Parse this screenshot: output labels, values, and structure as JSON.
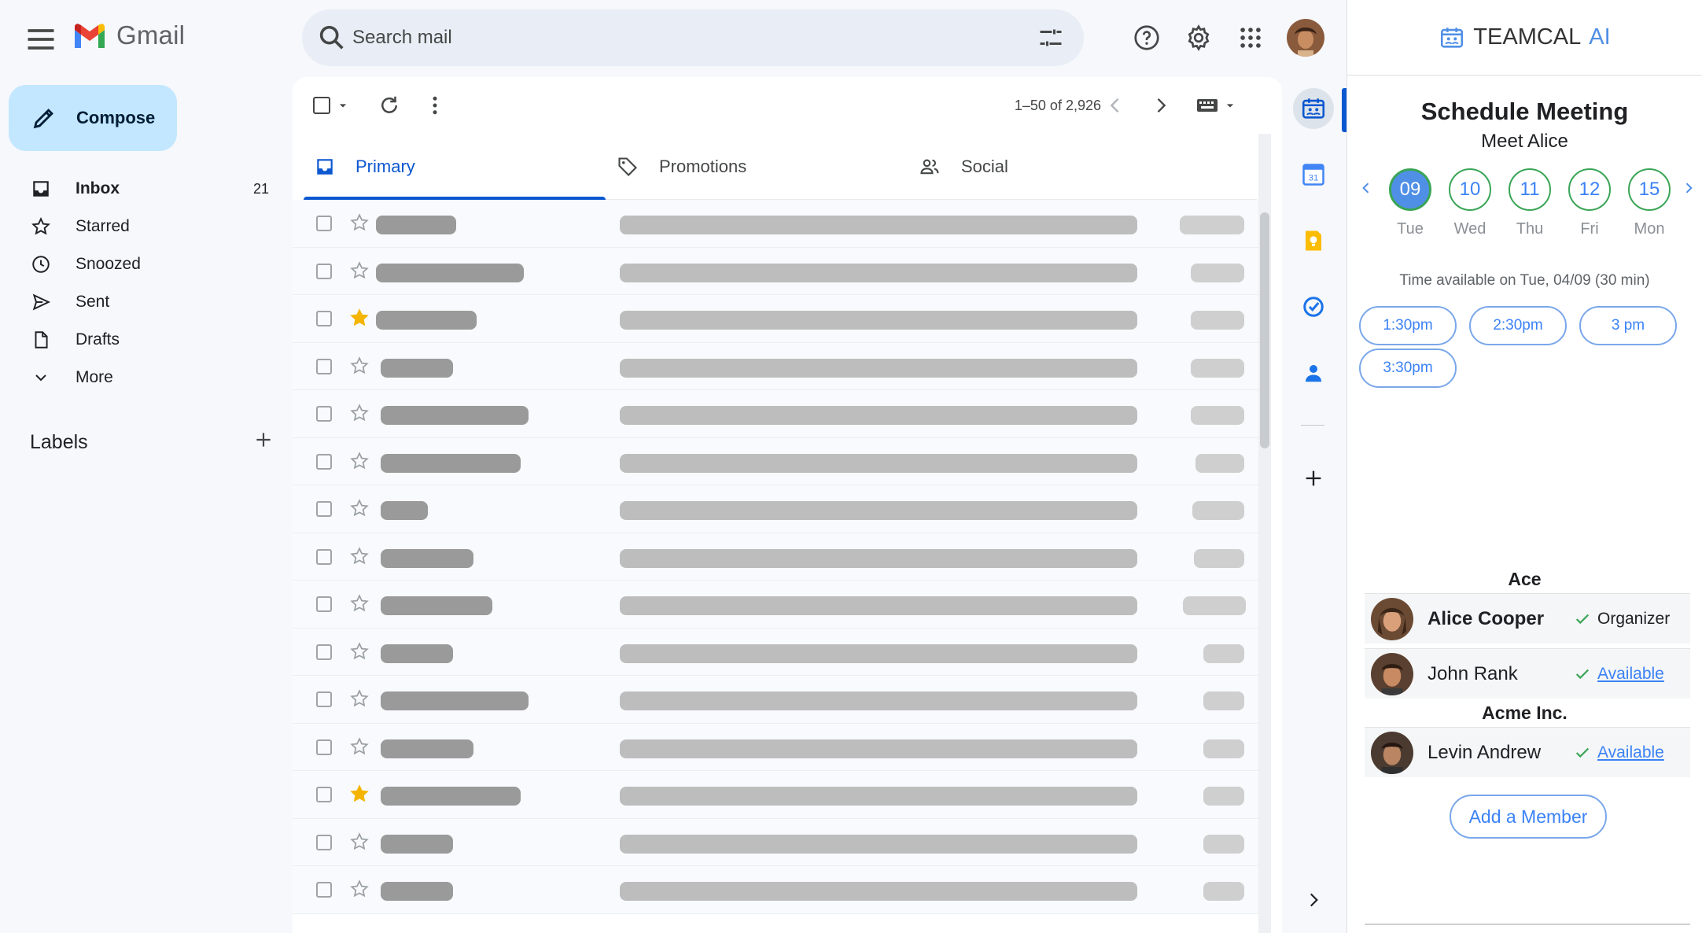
{
  "gmail": {
    "logo_text": "Gmail",
    "search": {
      "placeholder": "Search mail"
    },
    "compose_label": "Compose",
    "nav": [
      {
        "label": "Inbox",
        "count": "21",
        "icon": "inbox-icon"
      },
      {
        "label": "Starred",
        "icon": "star-icon"
      },
      {
        "label": "Snoozed",
        "icon": "clock-icon"
      },
      {
        "label": "Sent",
        "icon": "send-icon"
      },
      {
        "label": "Drafts",
        "icon": "draft-icon"
      },
      {
        "label": "More",
        "icon": "chevron-down-icon"
      }
    ],
    "labels_heading": "Labels",
    "pager": "1–50 of 2,926",
    "tabs": [
      {
        "label": "Primary",
        "icon": "inbox-icon"
      },
      {
        "label": "Promotions",
        "icon": "tag-icon"
      },
      {
        "label": "Social",
        "icon": "people-icon"
      }
    ],
    "rows_starred": [
      false,
      false,
      true,
      false,
      false,
      false,
      false,
      false,
      false,
      false,
      false,
      false,
      true,
      false,
      false
    ]
  },
  "teamcal": {
    "brand": "TEAMCAL",
    "brand_ai": "AI",
    "title": "Schedule Meeting",
    "subtitle": "Meet Alice",
    "days": [
      {
        "num": "09",
        "name": "Tue",
        "selected": true
      },
      {
        "num": "10",
        "name": "Wed"
      },
      {
        "num": "11",
        "name": "Thu"
      },
      {
        "num": "12",
        "name": "Fri"
      },
      {
        "num": "15",
        "name": "Mon"
      }
    ],
    "availability_text": "Time available on Tue, 04/09 (30 min)",
    "slots": [
      "1:30pm",
      "2:30pm",
      "3 pm",
      "3:30pm"
    ],
    "groups": [
      {
        "org": "Ace",
        "members": [
          {
            "name": "Alice Cooper",
            "status": "Organizer",
            "is_link": false
          },
          {
            "name": "John Rank",
            "status": "Available",
            "is_link": true
          }
        ]
      },
      {
        "org": "Acme Inc.",
        "members": [
          {
            "name": "Levin Andrew",
            "status": "Available",
            "is_link": true
          }
        ]
      }
    ],
    "add_member_label": "Add a Member"
  },
  "colors": {
    "accent_blue": "#0b57d0",
    "compose_bg": "#c2e7ff",
    "teamcal_blue": "#4f8fe6",
    "available_green": "#3aa556"
  }
}
